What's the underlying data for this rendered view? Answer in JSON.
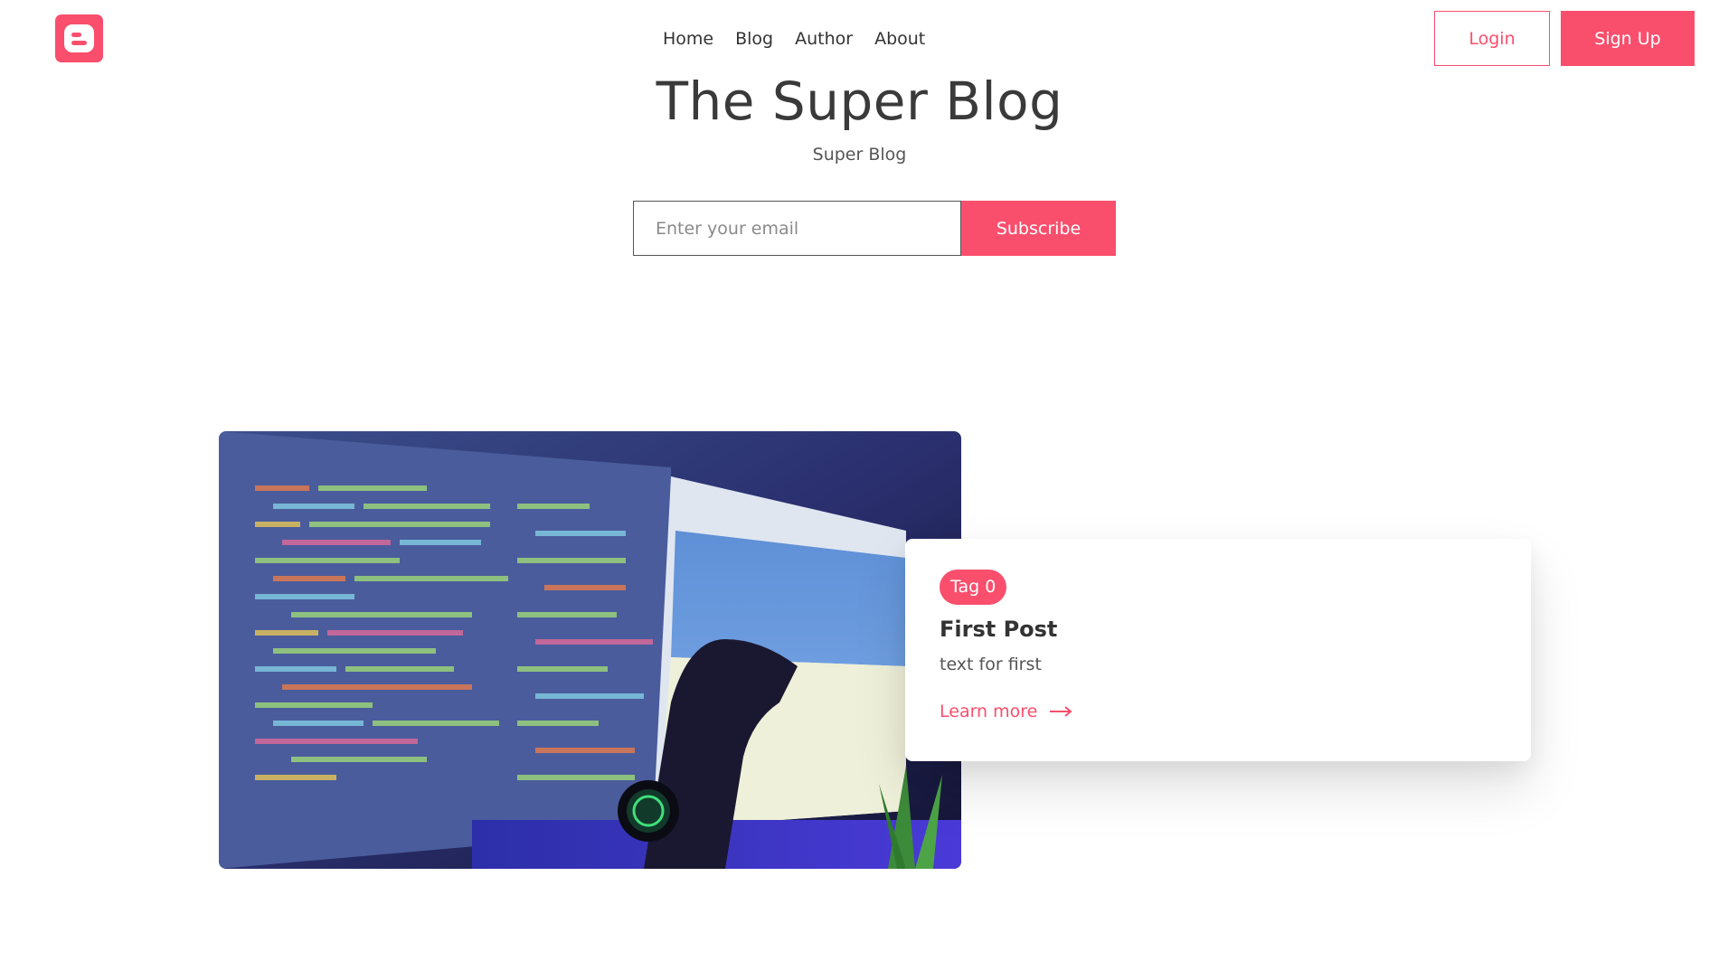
{
  "brand": {
    "logo_icon": "blogger-icon",
    "accent_color": "#f94f6d"
  },
  "nav": {
    "items": [
      {
        "label": "Home"
      },
      {
        "label": "Blog"
      },
      {
        "label": "Author"
      },
      {
        "label": "About"
      }
    ]
  },
  "auth": {
    "login_label": "Login",
    "signup_label": "Sign Up"
  },
  "hero": {
    "title": "The Super Blog",
    "subtitle": "Super Blog"
  },
  "subscribe": {
    "email_placeholder": "Enter your email",
    "email_value": "",
    "button_label": "Subscribe"
  },
  "posts": [
    {
      "tag": "Tag 0",
      "title": "First Post",
      "text": "text for first",
      "link_label": "Learn more",
      "link_icon": "arrow-right-icon"
    }
  ]
}
